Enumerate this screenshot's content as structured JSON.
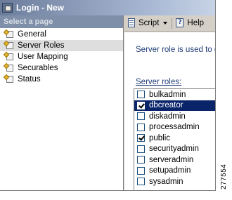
{
  "window": {
    "title": "Login - New"
  },
  "left_pane": {
    "header": "Select a page",
    "pages": [
      {
        "label": "General",
        "selected": false
      },
      {
        "label": "Server Roles",
        "selected": true
      },
      {
        "label": "User Mapping",
        "selected": false
      },
      {
        "label": "Securables",
        "selected": false
      },
      {
        "label": "Status",
        "selected": false
      }
    ]
  },
  "toolbar": {
    "script_label": "Script",
    "help_label": "Help"
  },
  "content": {
    "description": "Server role is used to gr",
    "roles_label": "Server roles:",
    "roles": [
      {
        "name": "bulkadmin",
        "checked": false,
        "selected": false
      },
      {
        "name": "dbcreator",
        "checked": true,
        "selected": true
      },
      {
        "name": "diskadmin",
        "checked": false,
        "selected": false
      },
      {
        "name": "processadmin",
        "checked": false,
        "selected": false
      },
      {
        "name": "public",
        "checked": true,
        "selected": false
      },
      {
        "name": "securityadmin",
        "checked": false,
        "selected": false
      },
      {
        "name": "serveradmin",
        "checked": false,
        "selected": false
      },
      {
        "name": "setupadmin",
        "checked": false,
        "selected": false
      },
      {
        "name": "sysadmin",
        "checked": false,
        "selected": false
      }
    ]
  },
  "figure_id": "277554",
  "colors": {
    "selection": "#0a246a",
    "label_text": "#1f3c78",
    "header_bg": "#7f8fa9"
  }
}
